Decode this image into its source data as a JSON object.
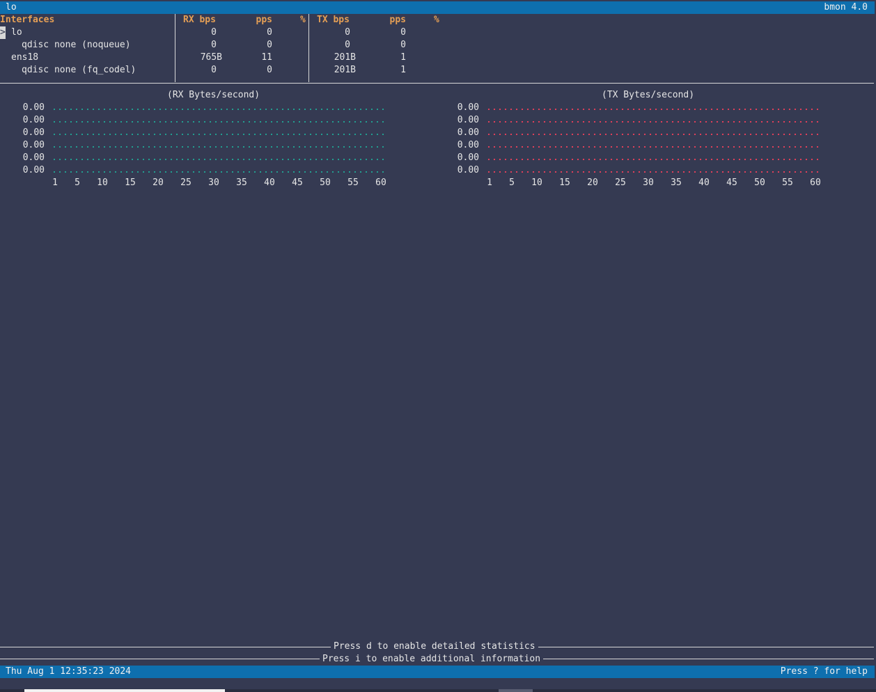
{
  "header": {
    "left": "lo",
    "right": "bmon 4.0"
  },
  "table": {
    "headers": {
      "interfaces": "Interfaces",
      "rx_bps": "RX bps",
      "rx_pps": "pps",
      "rx_pct": "%",
      "tx_bps": "TX bps",
      "tx_pps": "pps",
      "tx_pct": "%"
    },
    "cursor": ">",
    "rows": [
      {
        "name": "lo",
        "rx_bps": "0",
        "rx_pps": "0",
        "tx_bps": "0",
        "tx_pps": "0"
      },
      {
        "name": "qdisc none (noqueue)",
        "rx_bps": "0",
        "rx_pps": "0",
        "tx_bps": "0",
        "tx_pps": "0"
      },
      {
        "name": "ens18",
        "rx_bps": "765B",
        "rx_pps": "11",
        "tx_bps": "201B",
        "tx_pps": "1"
      },
      {
        "name": "qdisc none (fq_codel)",
        "rx_bps": "0",
        "rx_pps": "0",
        "tx_bps": "201B",
        "tx_pps": "1"
      }
    ]
  },
  "graphs": {
    "rx": {
      "title": "(RX Bytes/second)",
      "color": "#1fae9a"
    },
    "tx": {
      "title": "(TX Bytes/second)",
      "color": "#e8405a"
    },
    "y_labels": [
      "0.00",
      "0.00",
      "0.00",
      "0.00",
      "0.00",
      "0.00"
    ],
    "x_labels": [
      "1",
      "5",
      "10",
      "15",
      "20",
      "25",
      "30",
      "35",
      "40",
      "45",
      "50",
      "55",
      "60"
    ]
  },
  "chart_data": [
    {
      "type": "line",
      "title": "(RX Bytes/second)",
      "x": [
        "1",
        "5",
        "10",
        "15",
        "20",
        "25",
        "30",
        "35",
        "40",
        "45",
        "50",
        "55",
        "60"
      ],
      "series": [
        {
          "values": [
            0,
            0,
            0,
            0,
            0,
            0,
            0,
            0,
            0,
            0,
            0,
            0,
            0
          ]
        }
      ],
      "ylim": [
        0,
        0
      ]
    },
    {
      "type": "line",
      "title": "(TX Bytes/second)",
      "x": [
        "1",
        "5",
        "10",
        "15",
        "20",
        "25",
        "30",
        "35",
        "40",
        "45",
        "50",
        "55",
        "60"
      ],
      "series": [
        {
          "values": [
            0,
            0,
            0,
            0,
            0,
            0,
            0,
            0,
            0,
            0,
            0,
            0,
            0
          ]
        }
      ],
      "ylim": [
        0,
        0
      ]
    }
  ],
  "messages": {
    "detailed": "Press d to enable detailed statistics",
    "additional": "Press i to enable additional information"
  },
  "footer": {
    "left": "Thu Aug  1 12:35:23 2024",
    "right": "Press ? for help"
  },
  "colors": {
    "background": "#353a52",
    "bar": "#0e6fae",
    "header_text": "#e59f55"
  }
}
